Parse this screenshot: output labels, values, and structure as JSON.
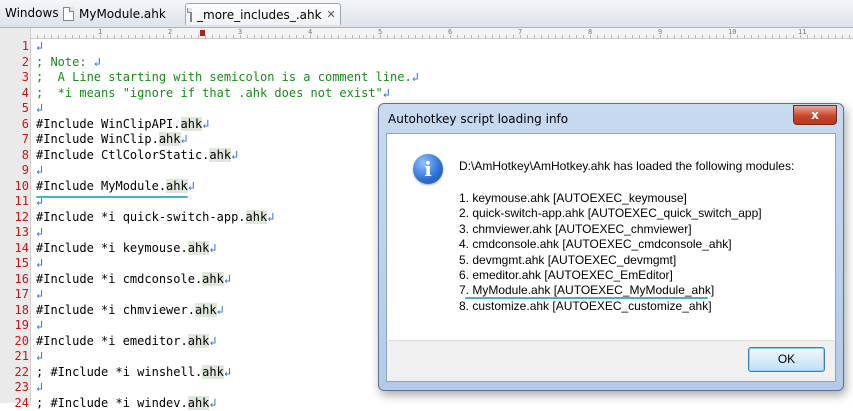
{
  "tabs": {
    "windows_label": "Windows",
    "items": [
      {
        "label": "MyModule.ahk"
      },
      {
        "label": "_more_includes_.ahk",
        "close": "✕"
      }
    ]
  },
  "ruler": {
    "labels": [
      "1",
      "2",
      "3",
      "4",
      "5",
      "6",
      "7",
      "8",
      "9",
      "10",
      "11"
    ]
  },
  "return_glyph": "↲",
  "editor": {
    "lines": [
      {
        "n": "1",
        "text": "",
        "type": "code"
      },
      {
        "n": "2",
        "text": "; Note: ",
        "type": "comment"
      },
      {
        "n": "3",
        "text": ";  A Line starting with semicolon is a comment line.",
        "type": "comment"
      },
      {
        "n": "4",
        "text": ";  *i means \"ignore if that .ahk does not exist\"",
        "type": "comment"
      },
      {
        "n": "5",
        "text": "",
        "type": "code"
      },
      {
        "n": "6",
        "text": "#Include WinClipAPI.",
        "ext": "ahk",
        "type": "code"
      },
      {
        "n": "7",
        "text": "#Include WinClip.",
        "ext": "ahk",
        "type": "code"
      },
      {
        "n": "8",
        "text": "#Include CtlColorStatic.",
        "ext": "ahk",
        "type": "code"
      },
      {
        "n": "9",
        "text": "",
        "type": "code"
      },
      {
        "n": "10",
        "text": "#Include MyModule.",
        "ext": "ahk",
        "type": "code"
      },
      {
        "n": "11",
        "text": "",
        "type": "code"
      },
      {
        "n": "12",
        "text": "#Include *i quick-switch-app.",
        "ext": "ahk",
        "type": "code"
      },
      {
        "n": "13",
        "text": "",
        "type": "code"
      },
      {
        "n": "14",
        "text": "#Include *i keymouse.",
        "ext": "ahk",
        "type": "code"
      },
      {
        "n": "15",
        "text": "",
        "type": "code"
      },
      {
        "n": "16",
        "text": "#Include *i cmdconsole.",
        "ext": "ahk",
        "type": "code"
      },
      {
        "n": "17",
        "text": "",
        "type": "code"
      },
      {
        "n": "18",
        "text": "#Include *i chmviewer.",
        "ext": "ahk",
        "type": "code"
      },
      {
        "n": "19",
        "text": "",
        "type": "code"
      },
      {
        "n": "20",
        "text": "#Include *i emeditor.",
        "ext": "ahk",
        "type": "code"
      },
      {
        "n": "21",
        "text": "",
        "type": "code"
      },
      {
        "n": "22",
        "text": "; #Include *i winshell.",
        "ext": "ahk",
        "type": "code"
      },
      {
        "n": "23",
        "text": "",
        "type": "code"
      },
      {
        "n": "24",
        "text": "; #Include *i windev.",
        "ext": "ahk",
        "type": "code"
      }
    ]
  },
  "dialog": {
    "title": "Autohotkey script loading info",
    "close": "x",
    "icon": "info-icon",
    "heading": "D:\\AmHotkey\\AmHotkey.ahk has loaded the following modules:",
    "modules": [
      "1. keymouse.ahk [AUTOEXEC_keymouse]",
      "2. quick-switch-app.ahk [AUTOEXEC_quick_switch_app]",
      "3. chmviewer.ahk [AUTOEXEC_chmviewer]",
      "4. cmdconsole.ahk [AUTOEXEC_cmdconsole_ahk]",
      "5. devmgmt.ahk [AUTOEXEC_devmgmt]",
      "6. emeditor.ahk [AUTOEXEC_EmEditor]",
      "7. MyModule.ahk [AUTOEXEC_MyModule_ahk]",
      "8. customize.ahk [AUTOEXEC_customize_ahk]"
    ],
    "ok_label": "OK"
  },
  "colors": {
    "line_numbers": "#c81515",
    "comment": "#1a8a1a",
    "ahk_highlight": "#dfe7dc",
    "annotation_underline": "#3fb6c2",
    "return_mark": "#2f6fd6"
  }
}
